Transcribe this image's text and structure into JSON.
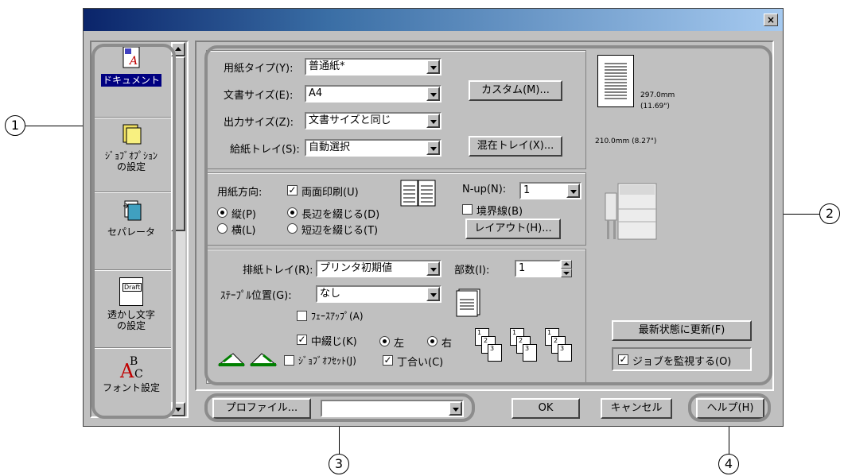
{
  "callouts": {
    "c1": "1",
    "c2": "2",
    "c3": "3",
    "c4": "4"
  },
  "close_glyph": "×",
  "sidebar": {
    "items": [
      {
        "label": "ドキュメント",
        "icon": "document-icon"
      },
      {
        "label": "ｼﾞｮﾌﾞｵﾌﾟｼｮﾝ\nの設定",
        "icon": "job-options-icon"
      },
      {
        "label": "セパレータ",
        "icon": "separator-icon"
      },
      {
        "label": "透かし文字\nの設定",
        "icon": "watermark-icon"
      },
      {
        "label": "フォント設定",
        "icon": "font-icon"
      }
    ],
    "watermark_thumb_text": "Draft"
  },
  "paper": {
    "type_label": "用紙タイプ(Y):",
    "type_value": "普通紙*",
    "doc_size_label": "文書サイズ(E):",
    "doc_size_value": "A4",
    "out_size_label": "出力サイズ(Z):",
    "out_size_value": "文書サイズと同じ",
    "tray_label": "給紙トレイ(S):",
    "tray_value": "自動選択",
    "custom_button": "カスタム(M)...",
    "mixed_tray_button": "混在トレイ(X)..."
  },
  "preview": {
    "height": "297.0mm",
    "height_in": "(11.69\")",
    "width": "210.0mm (8.27\")"
  },
  "orientation": {
    "label": "用紙方向:",
    "duplex": "両面印刷(U)",
    "portrait": "縦(P)",
    "landscape": "横(L)",
    "long_edge": "長辺を綴じる(D)",
    "short_edge": "短辺を綴じる(T)",
    "nup_label": "N-up(N):",
    "nup_value": "1",
    "border": "境界線(B)",
    "layout_button": "レイアウト(H)..."
  },
  "output": {
    "tray_label": "排紙トレイ(R):",
    "tray_value": "プリンタ初期値",
    "copies_label": "部数(I):",
    "copies_value": "1",
    "staple_label": "ｽﾃｰﾌﾟﾙ位置(G):",
    "staple_value": "なし",
    "faceup": "ﾌｪｰｽｱｯﾌﾟ(A)",
    "center_bind": "中綴じ(K)",
    "left": "左",
    "right": "右",
    "offset": "ｼﾞｮﾌﾞｵﾌｾｯﾄ(J)",
    "collate": "丁合い(C)"
  },
  "status": {
    "refresh_button": "最新状態に更新(F)",
    "monitor_job": "ジョブを監視する(O)"
  },
  "footer": {
    "profile_button": "プロファイル...",
    "profile_value": "",
    "ok": "OK",
    "cancel": "キャンセル",
    "help": "ヘルプ(H)"
  }
}
